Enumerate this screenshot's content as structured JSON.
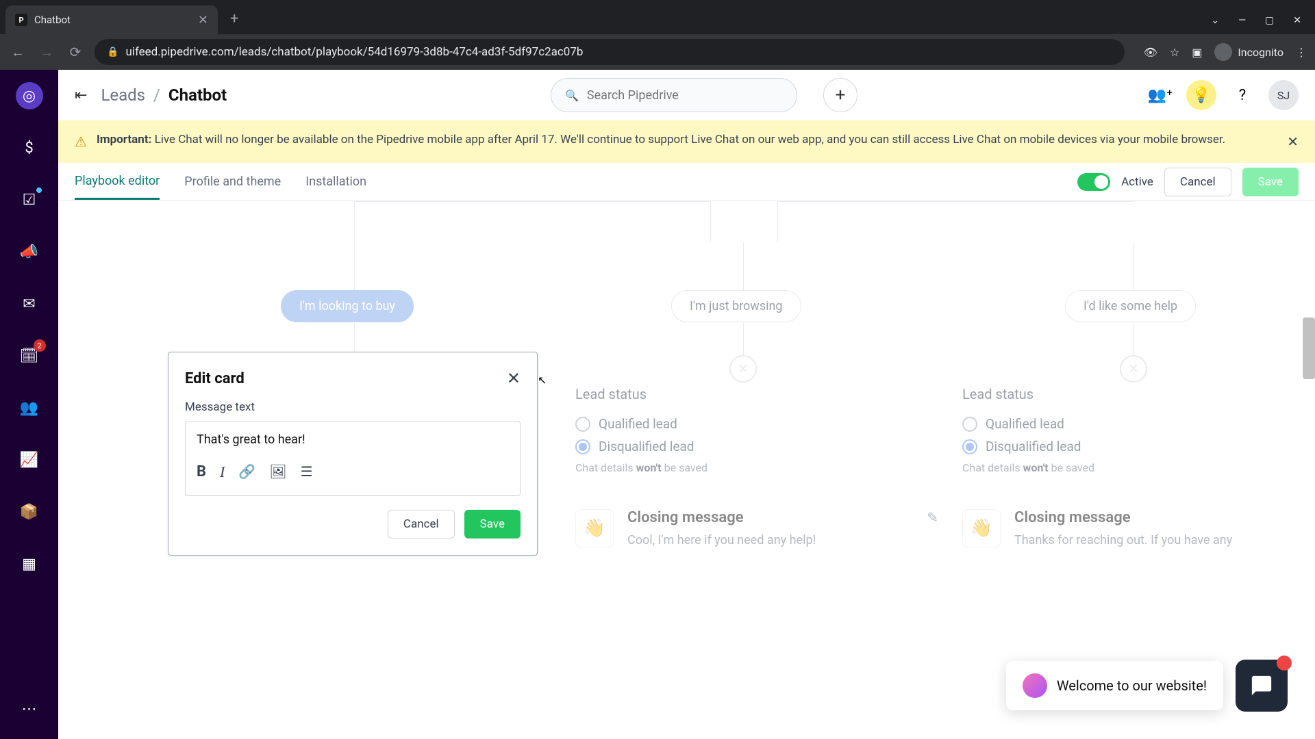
{
  "browser": {
    "tab_title": "Chatbot",
    "url": "uifeed.pipedrive.com/leads/chatbot/playbook/54d16979-3d8b-47c4-ad3f-5df97c2ac07b",
    "incognito_label": "Incognito"
  },
  "sidebar": {
    "badge_calendar": "2"
  },
  "topbar": {
    "collapse_glyph": "⇥",
    "breadcrumb_parent": "Leads",
    "breadcrumb_current": "Chatbot",
    "search_placeholder": "Search Pipedrive",
    "avatar_initials": "SJ"
  },
  "banner": {
    "prefix": "Important:",
    "text": " Live Chat will no longer be available on the Pipedrive mobile app after April 17. We'll continue to support Live Chat on our web app, and you can still access Live Chat on mobile devices via your mobile browser."
  },
  "tabs": {
    "editor": "Playbook editor",
    "profile": "Profile and theme",
    "install": "Installation",
    "active_label": "Active",
    "cancel": "Cancel",
    "save": "Save"
  },
  "flow": {
    "pill_buy": "I'm looking to buy",
    "pill_browse": "I'm just browsing",
    "pill_help": "I'd like some help",
    "lead_status_title": "Lead status",
    "qualified": "Qualified lead",
    "disqualified": "Disqualified lead",
    "details_pre": "Chat details ",
    "details_bold": "won't",
    "details_post": " be saved",
    "closing_title": "Closing message",
    "closing_browse": "Cool, I'm here if you need any help!",
    "closing_help": "Thanks for reaching out. If you have any"
  },
  "edit_card": {
    "title": "Edit card",
    "label": "Message text",
    "value": "That's great to hear!",
    "cancel": "Cancel",
    "save": "Save"
  },
  "chat_widget": {
    "welcome": "Welcome to our website!"
  }
}
